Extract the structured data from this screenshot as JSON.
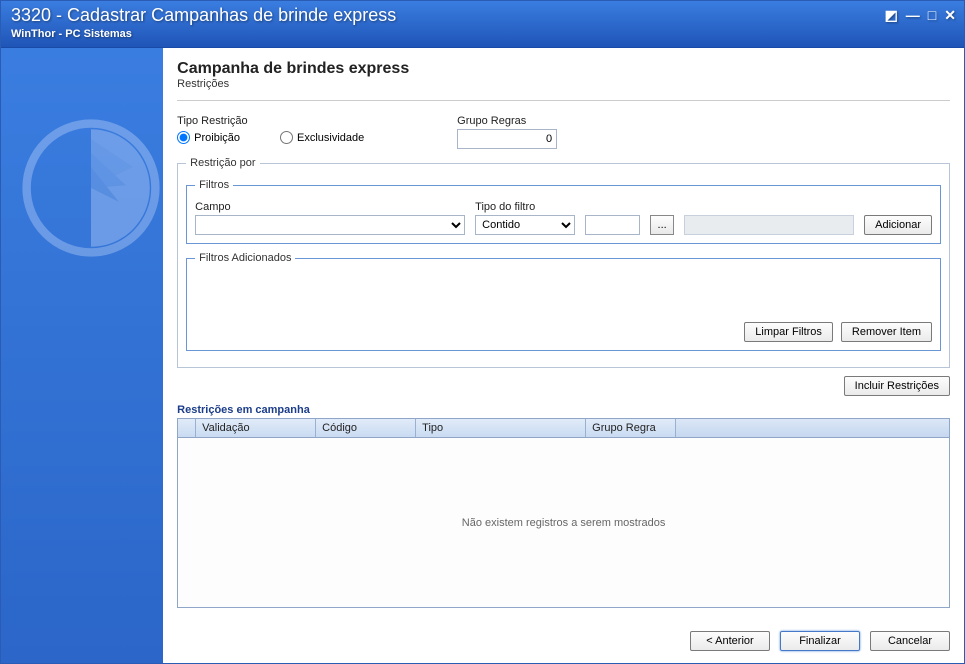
{
  "titlebar": {
    "title": "3320 - Cadastrar Campanhas de brinde express",
    "subtitle": "WinThor - PC Sistemas"
  },
  "page": {
    "title": "Campanha de brindes express",
    "subtitle": "Restrições"
  },
  "tipo_restricao": {
    "label": "Tipo Restrição",
    "options": {
      "proibicao": "Proibição",
      "exclusividade": "Exclusividade"
    },
    "selected": "proibicao"
  },
  "grupo_regras": {
    "label": "Grupo Regras",
    "value": "0"
  },
  "restricao_por": {
    "legend": "Restrição por",
    "filtros": {
      "legend": "Filtros",
      "campo_label": "Campo",
      "tipo_filtro_label": "Tipo do filtro",
      "tipo_filtro_value": "Contido",
      "dots_label": "...",
      "adicionar_label": "Adicionar"
    },
    "filtros_adicionados": {
      "legend": "Filtros Adicionados",
      "limpar_label": "Limpar Filtros",
      "remover_label": "Remover Item"
    }
  },
  "incluir_restricoes_label": "Incluir Restrições",
  "grid": {
    "title": "Restrições em campanha",
    "columns": [
      "Validação",
      "Código",
      "Tipo",
      "Grupo Regra"
    ],
    "empty_text": "Não existem registros a serem mostrados"
  },
  "footer": {
    "anterior": "< Anterior",
    "finalizar": "Finalizar",
    "cancelar": "Cancelar"
  }
}
